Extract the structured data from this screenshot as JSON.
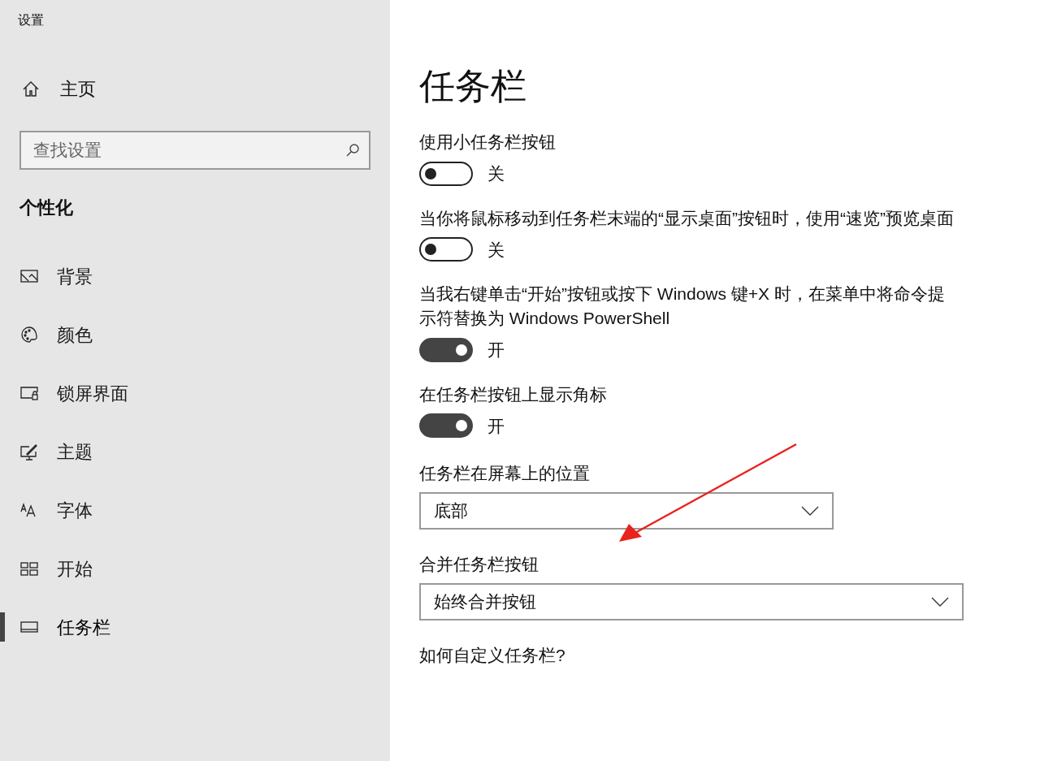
{
  "window": {
    "title": "设置"
  },
  "sidebar": {
    "home": "主页",
    "search": {
      "placeholder": "查找设置"
    },
    "section": "个性化",
    "items": [
      {
        "label": "背景",
        "selected": false
      },
      {
        "label": "颜色",
        "selected": false
      },
      {
        "label": "锁屏界面",
        "selected": false
      },
      {
        "label": "主题",
        "selected": false
      },
      {
        "label": "字体",
        "selected": false
      },
      {
        "label": "开始",
        "selected": false
      },
      {
        "label": "任务栏",
        "selected": true
      }
    ]
  },
  "page": {
    "title": "任务栏",
    "settings": [
      {
        "kind": "toggle",
        "label": "使用小任务栏按钮",
        "on": false,
        "state": "关"
      },
      {
        "kind": "toggle",
        "label": "当你将鼠标移动到任务栏末端的“显示桌面”按钮时，使用“速览”预览桌面",
        "on": false,
        "state": "关"
      },
      {
        "kind": "toggle",
        "label": "当我右键单击“开始”按钮或按下 Windows 键+X 时，在菜单中将命令提示符替换为 Windows PowerShell",
        "on": true,
        "state": "开"
      },
      {
        "kind": "toggle",
        "label": "在任务栏按钮上显示角标",
        "on": true,
        "state": "开"
      },
      {
        "kind": "dropdown",
        "label": "任务栏在屏幕上的位置",
        "value": "底部"
      },
      {
        "kind": "dropdown",
        "label": "合并任务栏按钮",
        "value": "始终合并按钮"
      },
      {
        "kind": "link",
        "label": "如何自定义任务栏?"
      }
    ]
  }
}
